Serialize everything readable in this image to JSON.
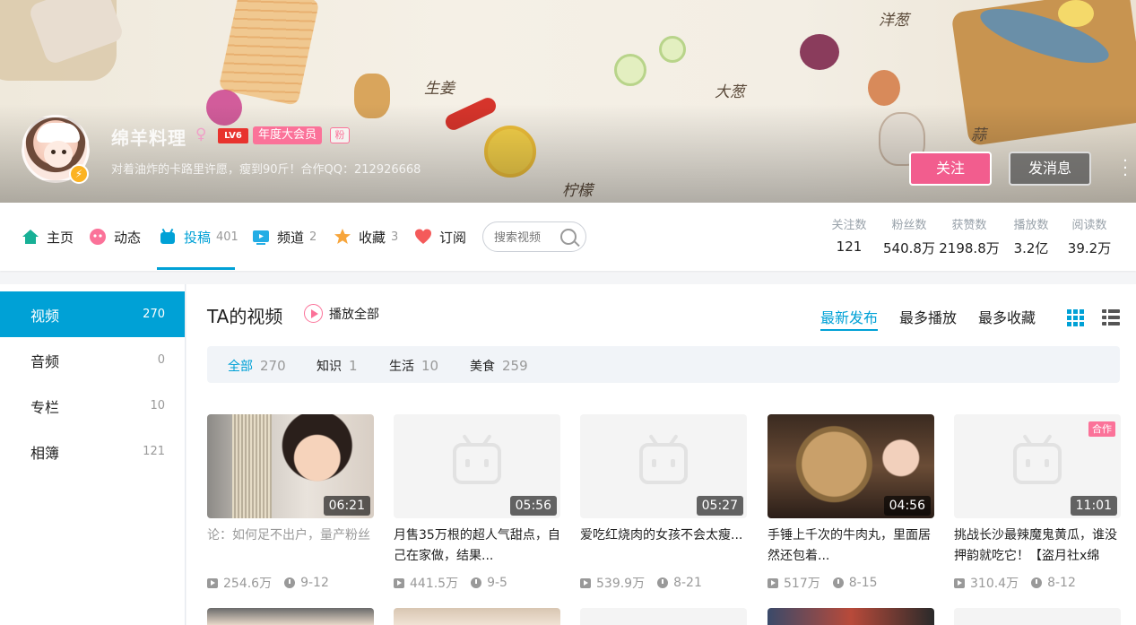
{
  "profile": {
    "name": "绵羊料理",
    "gender_icon": "female-icon",
    "level": "LV6",
    "vip": "年度大会员",
    "fan_badge": "粉",
    "sign": "对着油炸的卡路里许愿，瘦到90斤！合作QQ：212926668",
    "follow_label": "关注",
    "message_label": "发消息",
    "banner_labels": [
      "生姜",
      "大葱",
      "洋葱",
      "蒜",
      "柠檬"
    ]
  },
  "nav": {
    "items": [
      {
        "label": "主页",
        "count": "",
        "icon": "home-icon"
      },
      {
        "label": "动态",
        "count": "",
        "icon": "activity-icon"
      },
      {
        "label": "投稿",
        "count": "401",
        "icon": "upload-icon"
      },
      {
        "label": "频道",
        "count": "2",
        "icon": "channel-icon"
      },
      {
        "label": "收藏",
        "count": "3",
        "icon": "star-icon"
      },
      {
        "label": "订阅",
        "count": "",
        "icon": "heart-icon"
      }
    ],
    "search_placeholder": "搜索视频"
  },
  "stats": [
    {
      "label": "关注数",
      "value": "121"
    },
    {
      "label": "粉丝数",
      "value": "540.8万"
    },
    {
      "label": "获赞数",
      "value": "2198.8万"
    },
    {
      "label": "播放数",
      "value": "3.2亿"
    },
    {
      "label": "阅读数",
      "value": "39.2万"
    }
  ],
  "sidebar": {
    "items": [
      {
        "label": "视频",
        "count": "270"
      },
      {
        "label": "音频",
        "count": "0"
      },
      {
        "label": "专栏",
        "count": "10"
      },
      {
        "label": "相簿",
        "count": "121"
      }
    ]
  },
  "main": {
    "title": "TA的视频",
    "play_all": "播放全部",
    "sorts": [
      "最新发布",
      "最多播放",
      "最多收藏"
    ],
    "filters": [
      {
        "label": "全部",
        "count": "270"
      },
      {
        "label": "知识",
        "count": "1"
      },
      {
        "label": "生活",
        "count": "10"
      },
      {
        "label": "美食",
        "count": "259"
      }
    ],
    "videos": [
      {
        "duration": "06:21",
        "title": "论：如何足不出户，量产粉丝",
        "plays": "254.6万",
        "date": "9-12",
        "badge": ""
      },
      {
        "duration": "05:56",
        "title": "月售35万根的超人气甜点，自己在家做，结果...",
        "plays": "441.5万",
        "date": "9-5",
        "badge": ""
      },
      {
        "duration": "05:27",
        "title": "爱吃红烧肉的女孩不会太瘦...",
        "plays": "539.9万",
        "date": "8-21",
        "badge": ""
      },
      {
        "duration": "04:56",
        "title": "手锤上千次的牛肉丸，里面居然还包着...",
        "plays": "517万",
        "date": "8-15",
        "badge": ""
      },
      {
        "duration": "11:01",
        "title": "挑战长沙最辣魔鬼黄瓜，谁没押韵就吃它！【盗月社x绵",
        "plays": "310.4万",
        "date": "8-12",
        "badge": "合作"
      }
    ]
  },
  "colors": {
    "accent": "#00a1d6",
    "pink": "#fb7299",
    "follow": "#f25d8e"
  }
}
